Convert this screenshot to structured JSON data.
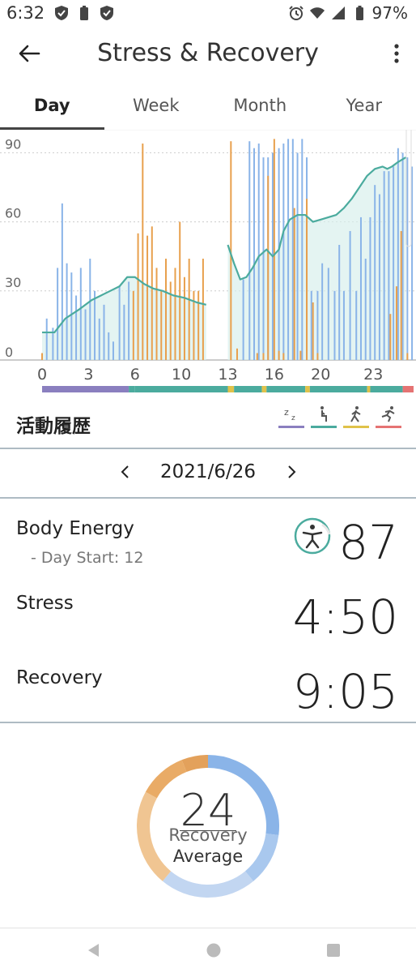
{
  "status_bar": {
    "time": "6:32",
    "battery": "97%",
    "left_icons": [
      "shield-check-icon",
      "battery-saver-icon",
      "shield-check-icon"
    ],
    "right_icons": [
      "alarm-icon",
      "wifi-icon",
      "signal-icon",
      "battery-icon"
    ]
  },
  "header": {
    "title": "Stress & Recovery",
    "back_icon": "arrow-left-icon",
    "menu_icon": "more-vertical-icon"
  },
  "tabs": [
    {
      "label": "Day",
      "active": true
    },
    {
      "label": "Week",
      "active": false
    },
    {
      "label": "Month",
      "active": false
    },
    {
      "label": "Year",
      "active": false
    }
  ],
  "chart_data": {
    "type": "bar",
    "y_ticks": [
      "90",
      "60",
      "30",
      "0"
    ],
    "ylim": [
      0,
      100
    ],
    "x_ticks": [
      "0",
      "3",
      "6",
      "10",
      "13",
      "16",
      "20",
      "23"
    ],
    "x_tick_hours": [
      0,
      3,
      6,
      9,
      12,
      15,
      18,
      21.4
    ],
    "xlim": [
      0,
      24
    ],
    "grid": true,
    "colors": {
      "recovery": "#8ab4e8",
      "stress": "#e8a04d",
      "body_energy_line": "#4bab9e",
      "body_energy_fill": "#d8efec"
    },
    "recovery_bars": [
      [
        0.3,
        18
      ],
      [
        0.7,
        14
      ],
      [
        1.0,
        40
      ],
      [
        1.3,
        68
      ],
      [
        1.6,
        42
      ],
      [
        1.9,
        38
      ],
      [
        2.2,
        28
      ],
      [
        2.5,
        40
      ],
      [
        2.8,
        22
      ],
      [
        3.1,
        44
      ],
      [
        3.4,
        30
      ],
      [
        3.7,
        18
      ],
      [
        4.0,
        24
      ],
      [
        4.3,
        12
      ],
      [
        4.6,
        8
      ],
      [
        5.0,
        32
      ],
      [
        5.3,
        24
      ],
      [
        5.6,
        34
      ],
      [
        13.0,
        35
      ],
      [
        13.4,
        95
      ],
      [
        13.7,
        92
      ],
      [
        14.0,
        94
      ],
      [
        14.3,
        88
      ],
      [
        14.6,
        88
      ],
      [
        14.9,
        90
      ],
      [
        15.3,
        92
      ],
      [
        15.6,
        94
      ],
      [
        15.9,
        96
      ],
      [
        16.2,
        96
      ],
      [
        16.5,
        90
      ],
      [
        16.8,
        96
      ],
      [
        17.1,
        88
      ],
      [
        17.4,
        30
      ],
      [
        17.8,
        30
      ],
      [
        18.1,
        42
      ],
      [
        18.5,
        40
      ],
      [
        18.9,
        30
      ],
      [
        19.2,
        50
      ],
      [
        19.5,
        30
      ],
      [
        19.9,
        56
      ],
      [
        20.3,
        30
      ],
      [
        20.6,
        62
      ],
      [
        20.9,
        44
      ],
      [
        21.2,
        62
      ],
      [
        21.5,
        76
      ],
      [
        21.8,
        72
      ],
      [
        22.1,
        82
      ],
      [
        22.4,
        82
      ],
      [
        22.7,
        84
      ],
      [
        23.0,
        92
      ],
      [
        23.3,
        90
      ],
      [
        23.6,
        88
      ],
      [
        23.9,
        84
      ]
    ],
    "stress_bars": [
      [
        0.0,
        3
      ],
      [
        5.9,
        30
      ],
      [
        6.2,
        55
      ],
      [
        6.5,
        94
      ],
      [
        6.8,
        54
      ],
      [
        7.1,
        58
      ],
      [
        7.4,
        40
      ],
      [
        7.7,
        30
      ],
      [
        8.0,
        44
      ],
      [
        8.3,
        34
      ],
      [
        8.6,
        40
      ],
      [
        8.9,
        60
      ],
      [
        9.2,
        36
      ],
      [
        9.5,
        44
      ],
      [
        9.8,
        30
      ],
      [
        10.1,
        30
      ],
      [
        10.4,
        44
      ],
      [
        12.2,
        95
      ],
      [
        12.6,
        5
      ],
      [
        13.9,
        3
      ],
      [
        14.3,
        3
      ],
      [
        14.6,
        80
      ],
      [
        15.0,
        96
      ],
      [
        15.3,
        4
      ],
      [
        15.6,
        3
      ],
      [
        16.3,
        66
      ],
      [
        16.7,
        4
      ],
      [
        17.1,
        70
      ],
      [
        17.5,
        25
      ],
      [
        17.8,
        3
      ],
      [
        22.5,
        20
      ],
      [
        22.9,
        32
      ],
      [
        23.2,
        56
      ],
      [
        23.6,
        3
      ]
    ],
    "body_energy": [
      [
        0.0,
        12
      ],
      [
        0.8,
        12
      ],
      [
        1.5,
        18
      ],
      [
        2.4,
        22
      ],
      [
        3.2,
        26
      ],
      [
        3.8,
        28
      ],
      [
        4.4,
        30
      ],
      [
        5.0,
        32
      ],
      [
        5.5,
        36
      ],
      [
        6.0,
        36
      ],
      [
        6.6,
        33
      ],
      [
        7.2,
        31
      ],
      [
        7.8,
        30
      ],
      [
        8.5,
        28
      ],
      [
        9.2,
        27
      ],
      [
        10.0,
        25
      ],
      [
        10.6,
        24
      ],
      [
        null,
        null
      ],
      [
        12.0,
        50
      ],
      [
        12.4,
        42
      ],
      [
        12.8,
        35
      ],
      [
        13.2,
        36
      ],
      [
        13.6,
        40
      ],
      [
        14.0,
        45
      ],
      [
        14.5,
        48
      ],
      [
        14.9,
        45
      ],
      [
        15.3,
        48
      ],
      [
        15.6,
        56
      ],
      [
        16.0,
        61
      ],
      [
        16.5,
        63
      ],
      [
        17.0,
        63
      ],
      [
        17.5,
        60
      ],
      [
        18.0,
        61
      ],
      [
        18.5,
        62
      ],
      [
        19.0,
        63
      ],
      [
        19.5,
        66
      ],
      [
        20.0,
        70
      ],
      [
        20.5,
        75
      ],
      [
        21.0,
        80
      ],
      [
        21.5,
        83
      ],
      [
        22.0,
        84
      ],
      [
        22.3,
        83
      ],
      [
        22.6,
        84
      ],
      [
        23.0,
        86
      ],
      [
        23.5,
        88
      ]
    ],
    "activity_colors": [
      "#8a7fbf",
      "#4bab9e",
      "#e0c24a",
      "#e57373"
    ]
  },
  "activity_section": {
    "title": "活動履歴",
    "legend": [
      {
        "icon": "sleep-icon",
        "color": "#8a7fbf"
      },
      {
        "icon": "sitting-icon",
        "color": "#4bab9e"
      },
      {
        "icon": "walking-icon",
        "color": "#e0c24a"
      },
      {
        "icon": "running-icon",
        "color": "#e57373"
      }
    ]
  },
  "date_nav": {
    "date": "2021/6/26",
    "prev_icon": "chevron-left-icon",
    "next_icon": "chevron-right-icon"
  },
  "metrics": {
    "body_energy": {
      "label": "Body Energy",
      "sub": "- Day Start: 12",
      "value": "87",
      "icon": "body-energy-icon"
    },
    "stress": {
      "label": "Stress",
      "value": "4:50"
    },
    "recovery": {
      "label": "Recovery",
      "value": "9:05"
    }
  },
  "recovery_average": {
    "value": "24",
    "label_line1": "Recovery",
    "label_line2": "Average",
    "segments": [
      {
        "fraction": 0.27,
        "color": "#8ab4e8"
      },
      {
        "fraction": 0.12,
        "color": "#a9c8ee"
      },
      {
        "fraction": 0.22,
        "color": "#c2d6f1"
      },
      {
        "fraction": 0.22,
        "color": "#f0c592"
      },
      {
        "fraction": 0.11,
        "color": "#e9ab66"
      },
      {
        "fraction": 0.06,
        "color": "#e3a15b"
      }
    ]
  },
  "nav_bar": {
    "icons": [
      "back-triangle-icon",
      "home-circle-icon",
      "recents-square-icon"
    ]
  }
}
